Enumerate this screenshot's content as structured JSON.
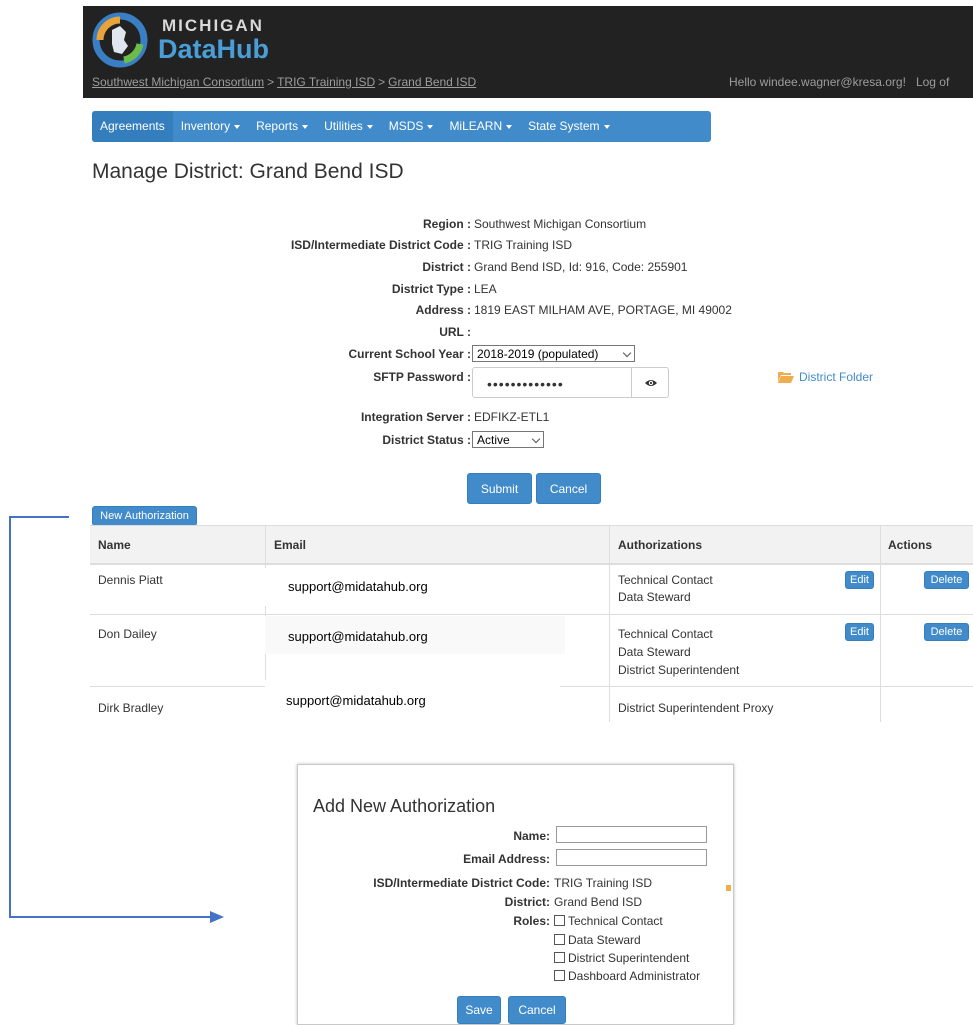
{
  "header": {
    "logo_top": "MICHIGAN",
    "logo_bottom": "DataHub",
    "breadcrumb": [
      "Southwest Michigan Consortium",
      "TRIG Training ISD",
      "Grand Bend ISD"
    ],
    "breadcrumb_sep": ">",
    "greeting": "Hello windee.wagner@kresa.org!",
    "logoff": "Log of"
  },
  "nav": {
    "items": [
      {
        "label": "Agreements",
        "dropdown": false
      },
      {
        "label": "Inventory",
        "dropdown": true
      },
      {
        "label": "Reports",
        "dropdown": true
      },
      {
        "label": "Utilities",
        "dropdown": true
      },
      {
        "label": "MSDS",
        "dropdown": true
      },
      {
        "label": "MiLEARN",
        "dropdown": true
      },
      {
        "label": "State System",
        "dropdown": true
      }
    ]
  },
  "page": {
    "title": "Manage District: Grand Bend ISD"
  },
  "details": {
    "region_label": "Region :",
    "region_value": "Southwest Michigan Consortium",
    "isd_label": "ISD/Intermediate District Code :",
    "isd_value": "TRIG Training ISD",
    "district_label": "District :",
    "district_value": "Grand Bend ISD, Id: 916, Code: 255901",
    "district_type_label": "District Type :",
    "district_type_value": "LEA",
    "address_label": "Address :",
    "address_value": "1819 EAST MILHAM AVE, PORTAGE, MI 49002",
    "url_label": "URL :",
    "url_value": "",
    "school_year_label": "Current School Year :",
    "school_year_value": "2018-2019 (populated)",
    "sftp_label": "SFTP Password :",
    "sftp_value": "•••••••••••••",
    "eye_icon": "eye-icon",
    "district_folder": "District Folder",
    "integration_label": "Integration Server :",
    "integration_value": "EDFIKZ-ETL1",
    "status_label": "District Status :",
    "status_value": "Active",
    "submit": "Submit",
    "cancel": "Cancel",
    "accent": "#428bca"
  },
  "authorizations": {
    "new_button": "New Authorization",
    "columns": [
      "Name",
      "Email",
      "Authorizations",
      "Actions"
    ],
    "edit_label": "Edit",
    "delete_label": "Delete",
    "rows": [
      {
        "name": "Dennis Piatt",
        "email": "support@midatahub.org",
        "auths": [
          "Technical Contact",
          "Data Steward"
        ]
      },
      {
        "name": "Don Dailey",
        "email": "support@midatahub.org",
        "auths": [
          "Technical Contact",
          "Data Steward",
          "District Superintendent"
        ]
      },
      {
        "name": "Dirk Bradley",
        "email": "support@midatahub.org",
        "auths": [
          "District Superintendent Proxy"
        ]
      }
    ]
  },
  "modal": {
    "title": "Add New Authorization",
    "name_label": "Name:",
    "email_label": "Email Address:",
    "isd_label": "ISD/Intermediate District Code:",
    "isd_value": "TRIG Training ISD",
    "district_label": "District:",
    "district_value": "Grand Bend ISD",
    "roles_label": "Roles:",
    "roles": [
      "Technical Contact",
      "Data Steward",
      "District Superintendent",
      "Dashboard Administrator"
    ],
    "save": "Save",
    "cancel": "Cancel"
  },
  "annotation": {
    "arrow_color": "#4472c4"
  }
}
